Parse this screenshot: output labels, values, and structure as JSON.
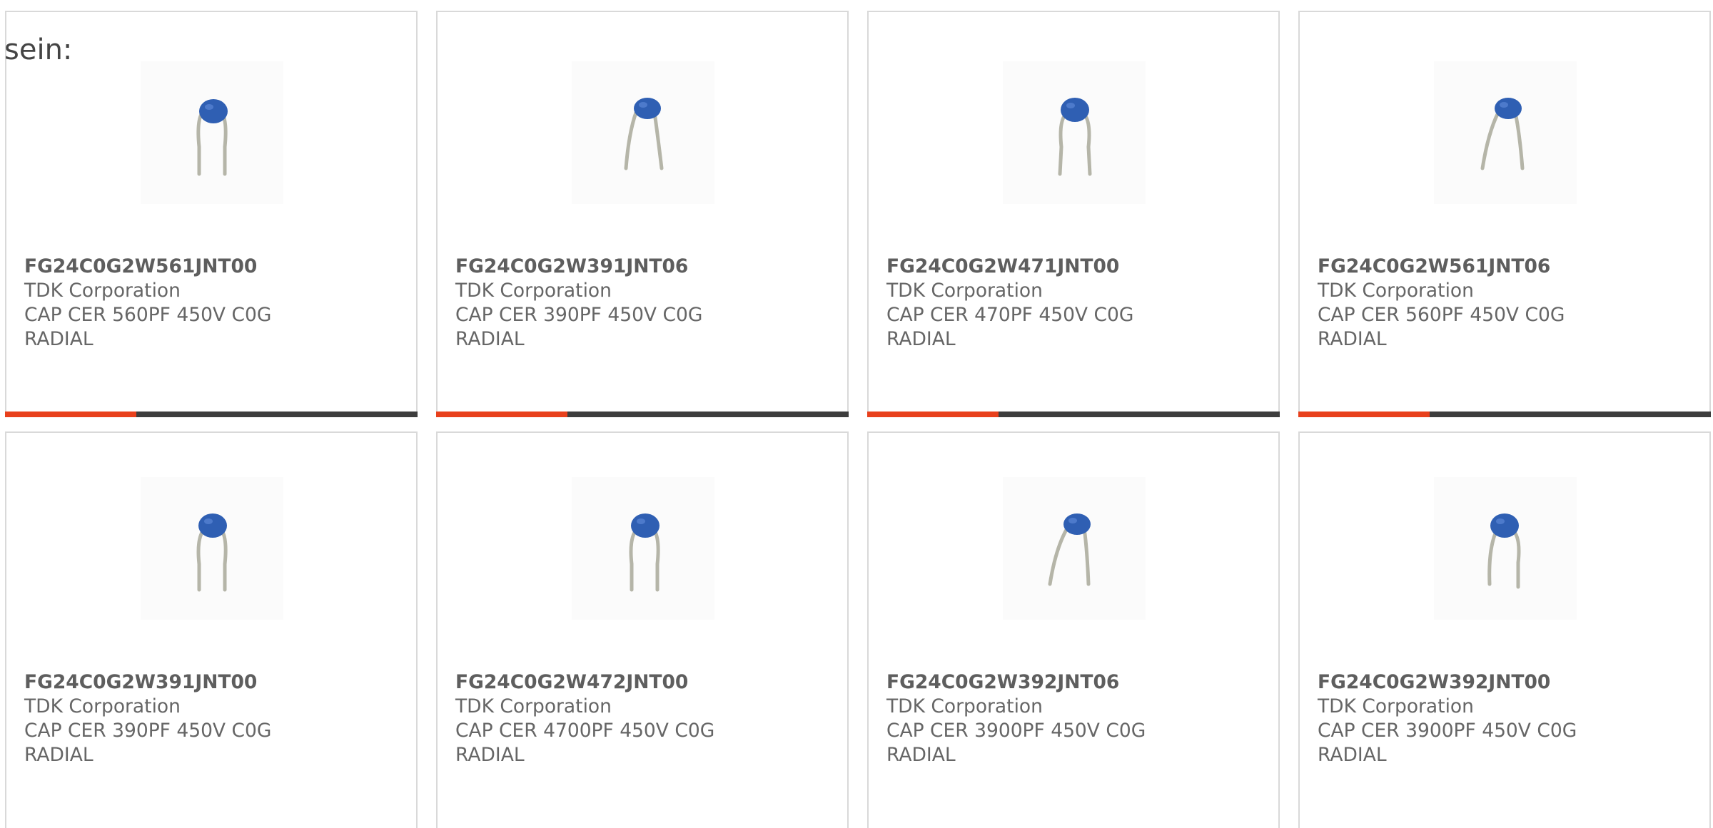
{
  "intro_text": "sein:",
  "colors": {
    "accent": "#e8401c",
    "bar_track": "#3d3d3d",
    "capacitor_body": "#2f5fb3",
    "text": "#666666"
  },
  "products": [
    {
      "part_number": "FG24C0G2W561JNT00",
      "manufacturer": "TDK Corporation",
      "description_line1": "CAP CER 560PF 450V C0G",
      "description_line2": "RADIAL",
      "image_icon": "radial-capacitor-icon"
    },
    {
      "part_number": "FG24C0G2W391JNT06",
      "manufacturer": "TDK Corporation",
      "description_line1": "CAP CER 390PF 450V C0G",
      "description_line2": "RADIAL",
      "image_icon": "radial-capacitor-icon"
    },
    {
      "part_number": "FG24C0G2W471JNT00",
      "manufacturer": "TDK Corporation",
      "description_line1": "CAP CER 470PF 450V C0G",
      "description_line2": "RADIAL",
      "image_icon": "radial-capacitor-icon"
    },
    {
      "part_number": "FG24C0G2W561JNT06",
      "manufacturer": "TDK Corporation",
      "description_line1": "CAP CER 560PF 450V C0G",
      "description_line2": "RADIAL",
      "image_icon": "radial-capacitor-icon"
    },
    {
      "part_number": "FG24C0G2W391JNT00",
      "manufacturer": "TDK Corporation",
      "description_line1": "CAP CER 390PF 450V C0G",
      "description_line2": "RADIAL",
      "image_icon": "radial-capacitor-icon"
    },
    {
      "part_number": "FG24C0G2W472JNT00",
      "manufacturer": "TDK Corporation",
      "description_line1": "CAP CER 4700PF 450V C0G",
      "description_line2": "RADIAL",
      "image_icon": "radial-capacitor-icon"
    },
    {
      "part_number": "FG24C0G2W392JNT06",
      "manufacturer": "TDK Corporation",
      "description_line1": "CAP CER 3900PF 450V C0G",
      "description_line2": "RADIAL",
      "image_icon": "radial-capacitor-icon"
    },
    {
      "part_number": "FG24C0G2W392JNT00",
      "manufacturer": "TDK Corporation",
      "description_line1": "CAP CER 3900PF 450V C0G",
      "description_line2": "RADIAL",
      "image_icon": "radial-capacitor-icon"
    }
  ]
}
